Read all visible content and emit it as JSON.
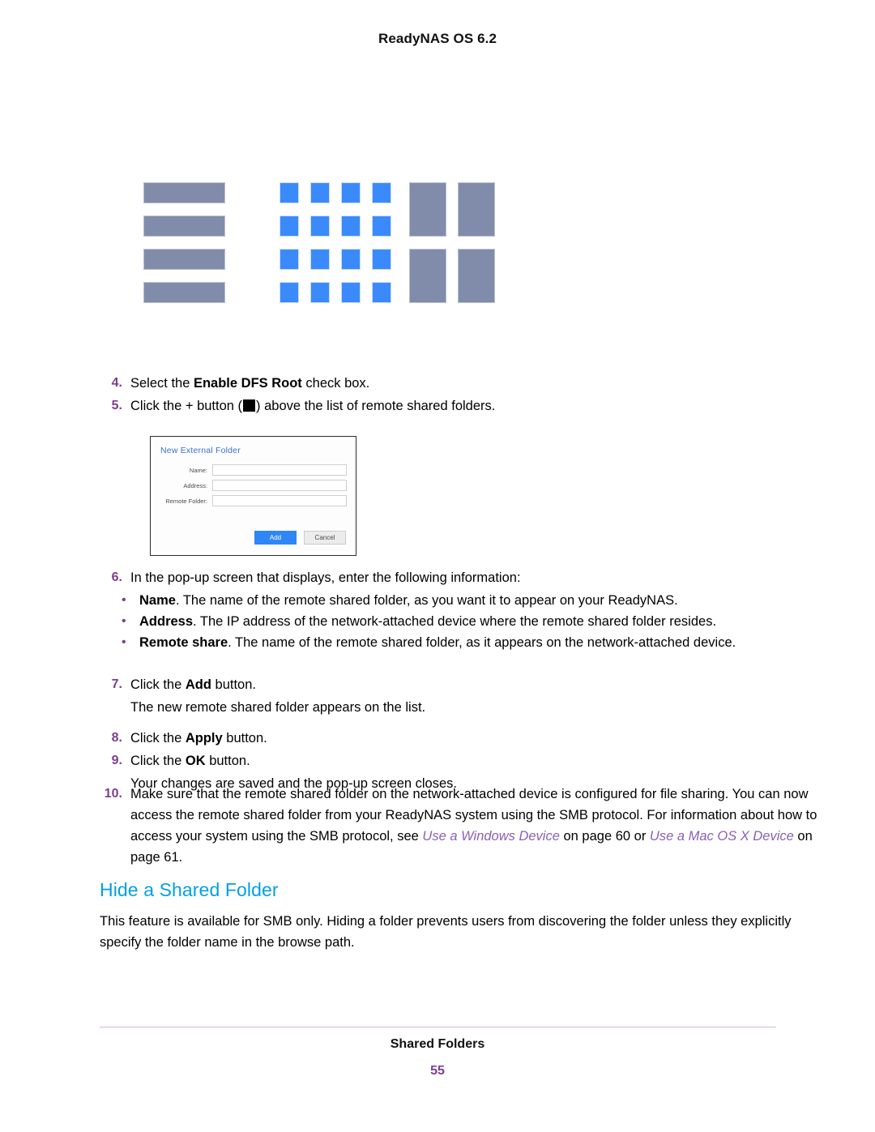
{
  "header": {
    "title": "ReadyNAS OS 6.2"
  },
  "view_graphic": {
    "list_view": {
      "rows": 4,
      "color": "#818cab",
      "border": "#b9c0d6"
    },
    "grid_view": {
      "rows": 4,
      "cols": 4,
      "color": "#3b8afc",
      "border": "#c9dcfe"
    },
    "tile_view": {
      "rows": 2,
      "cols": 2,
      "color": "#818cab",
      "border": "#b9c0d6"
    }
  },
  "steps": {
    "step4": {
      "num": "4.",
      "part1": "Select the ",
      "bold": "Enable DFS Root",
      "part2": " check box."
    },
    "step5": {
      "num": "5.",
      "part1": "Click the + button (",
      "part2": ") above the list of remote shared folders."
    },
    "step6": {
      "num": "6.",
      "text": "In the pop-up screen that displays, enter the following information:",
      "bullets": [
        {
          "marker": "•",
          "bold": "Name",
          "text": ". The name of the remote shared folder, as you want it to appear on your ReadyNAS."
        },
        {
          "marker": "•",
          "bold": "Address",
          "text": ". The IP address of the network-attached device where the remote shared folder resides."
        },
        {
          "marker": "•",
          "bold": "Remote share",
          "text": ". The name of the remote shared folder, as it appears on the network-attached device."
        }
      ]
    },
    "step7": {
      "num": "7.",
      "part1": "Click the ",
      "bold": "Add",
      "part2": " button.",
      "result": "The new remote shared folder appears on the list."
    },
    "step8": {
      "num": "8.",
      "part1": "Click the ",
      "bold": "Apply",
      "part2": " button."
    },
    "step9": {
      "num": "9.",
      "part1": "Click the ",
      "bold": "OK",
      "part2": " button.",
      "result": "Your changes are saved and the pop-up screen closes."
    },
    "step10": {
      "num": "10.",
      "line1": "Make sure that the remote shared folder on the network-attached device is configured for file sharing.",
      "line2": "You can now access the remote shared folder from your ReadyNAS system using the SMB protocol.",
      "line3_pre": "For information about how to access your system using the SMB protocol, see ",
      "xref1": "Use a Windows Device",
      "line3_mid": " on page 60 or ",
      "xref2": "Use a Mac OS X Device",
      "line3_post": " on page 61."
    }
  },
  "dialog": {
    "title": "New External Folder",
    "fields": [
      {
        "label": "Name:",
        "value": ""
      },
      {
        "label": "Address:",
        "value": ""
      },
      {
        "label": "Remote Folder:",
        "value": ""
      }
    ],
    "buttons": {
      "primary": "Add",
      "secondary": "Cancel"
    },
    "primary_color": "#2f86f6"
  },
  "section": {
    "heading": "Hide a Shared Folder",
    "heading_color": "#00a0e3",
    "body": "This feature is available for SMB only. Hiding a folder prevents users from discovering the folder unless they explicitly specify the folder name in the browse path."
  },
  "footer": {
    "title": "Shared Folders",
    "page_number": "55",
    "rule_color": "#d5b9d8",
    "page_color": "#7c3d92"
  }
}
